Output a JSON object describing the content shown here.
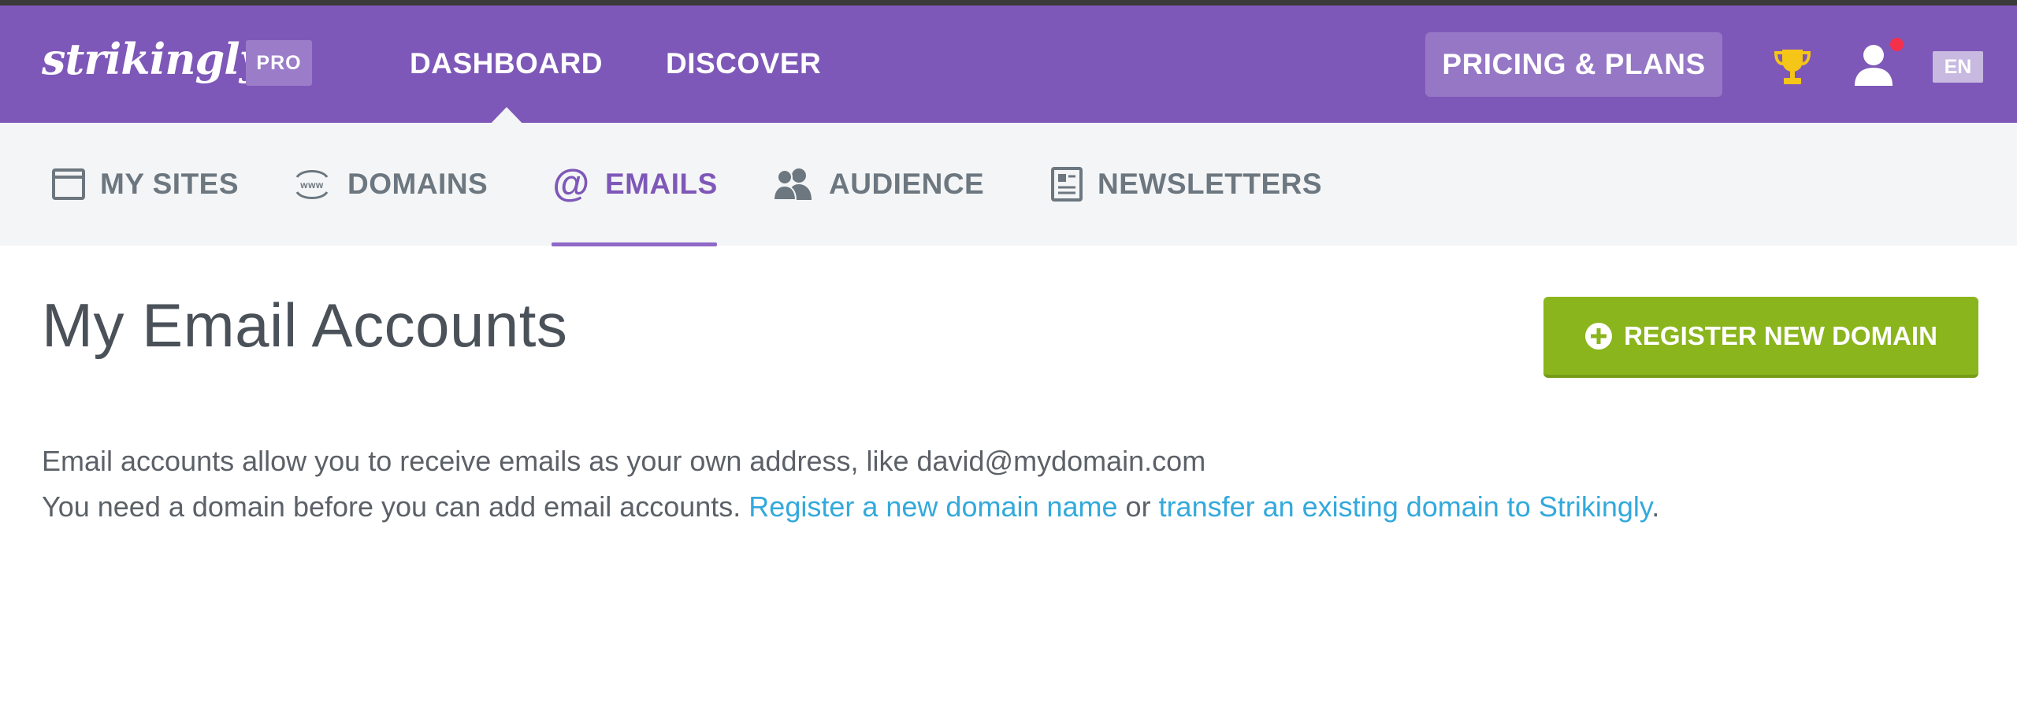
{
  "header": {
    "logo": "strikingly",
    "pro_badge": "PRO",
    "nav": {
      "dashboard": "DASHBOARD",
      "discover": "DISCOVER"
    },
    "pricing_button": "PRICING & PLANS",
    "language": "EN"
  },
  "subnav": {
    "my_sites": "MY SITES",
    "domains": "DOMAINS",
    "emails": "EMAILS",
    "audience": "AUDIENCE",
    "newsletters": "NEWSLETTERS",
    "active": "EMAILS"
  },
  "main": {
    "title": "My Email Accounts",
    "register_button": "REGISTER NEW DOMAIN",
    "info_line1": "Email accounts allow you to receive emails as your own address, like david@mydomain.com",
    "info_line2_prefix": "You need a domain before you can add email accounts. ",
    "register_link": "Register a new domain name",
    "or_text": " or ",
    "transfer_link": "transfer an existing domain to Strikingly",
    "period": "."
  },
  "colors": {
    "brand_purple": "#7e58b8",
    "accent_green": "#8ab51d",
    "link_blue": "#33a9dc",
    "notification_red": "#f4304a"
  }
}
